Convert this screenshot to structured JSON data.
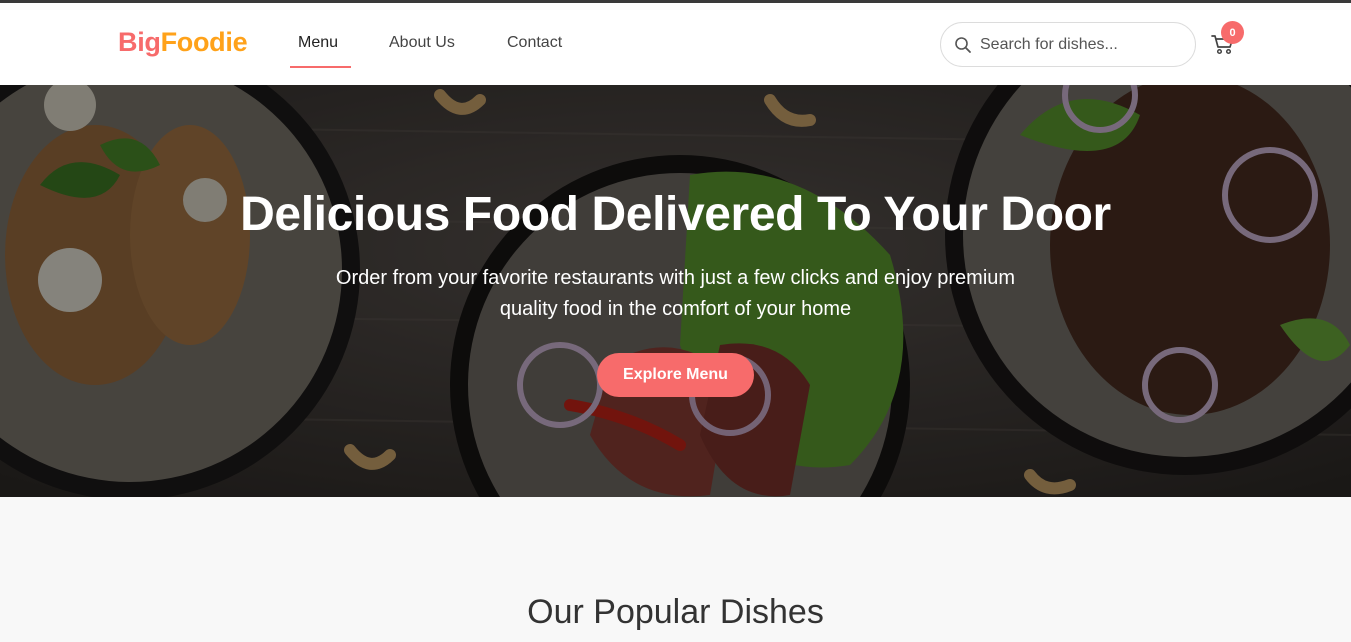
{
  "brand": {
    "part1": "Big",
    "part2": "Foodie",
    "color1": "#f76b6b",
    "color2": "#ffa21a"
  },
  "nav": {
    "items": [
      {
        "label": "Menu",
        "active": true
      },
      {
        "label": "About Us",
        "active": false
      },
      {
        "label": "Contact",
        "active": false
      }
    ]
  },
  "search": {
    "placeholder": "Search for dishes...",
    "value": "",
    "icon": "search-icon"
  },
  "cart": {
    "icon": "cart-icon",
    "count": "0"
  },
  "hero": {
    "title": "Delicious Food Delivered To Your Door",
    "subtitle": "Order from your favorite restaurants with just a few clicks and enjoy premium quality food in the comfort of your home",
    "button": "Explore Menu"
  },
  "popular": {
    "heading": "Our Popular Dishes"
  },
  "colors": {
    "accent": "#f76b6b",
    "brand_secondary": "#ffa21a"
  }
}
